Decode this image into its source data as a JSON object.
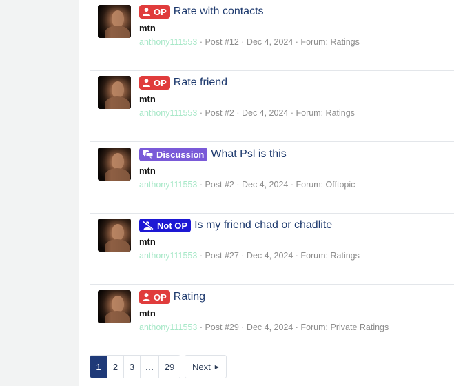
{
  "results": [
    {
      "badge": "OP",
      "badge_type": "op",
      "badge_icon": "user-icon",
      "title": "Rate with contacts",
      "snippet": "mtn",
      "user": "anthony111553",
      "meta": "· Post #12 · Dec 4, 2024 · Forum: Ratings"
    },
    {
      "badge": "OP",
      "badge_type": "op",
      "badge_icon": "user-icon",
      "title": "Rate friend",
      "snippet": "mtn",
      "user": "anthony111553",
      "meta": "· Post #2 · Dec 4, 2024 · Forum: Ratings"
    },
    {
      "badge": "Discussion",
      "badge_type": "discussion",
      "badge_icon": "chat-bubbles-icon",
      "title": "What Psl is this",
      "snippet": "mtn",
      "user": "anthony111553",
      "meta": "· Post #2 · Dec 4, 2024 · Forum: Offtopic"
    },
    {
      "badge": "Not OP",
      "badge_type": "notop",
      "badge_icon": "user-slash-icon",
      "title": "Is my friend chad or chadlite",
      "snippet": "mtn",
      "user": "anthony111553",
      "meta": "· Post #27 · Dec 4, 2024 · Forum: Ratings"
    },
    {
      "badge": "OP",
      "badge_type": "op",
      "badge_icon": "user-icon",
      "title": "Rating",
      "snippet": "mtn",
      "user": "anthony111553",
      "meta": "· Post #29 · Dec 4, 2024 · Forum: Private Ratings"
    }
  ],
  "pagination": {
    "pages": [
      "1",
      "2",
      "3",
      "…",
      "29"
    ],
    "current": "1",
    "next_label": "Next"
  },
  "colors": {
    "op": "#e03c3c",
    "discussion": "#7a5ad8",
    "notop": "#1d18d4",
    "title": "#1e3a6e",
    "username": "#a8e8c8",
    "current_page": "#1f3a78"
  }
}
